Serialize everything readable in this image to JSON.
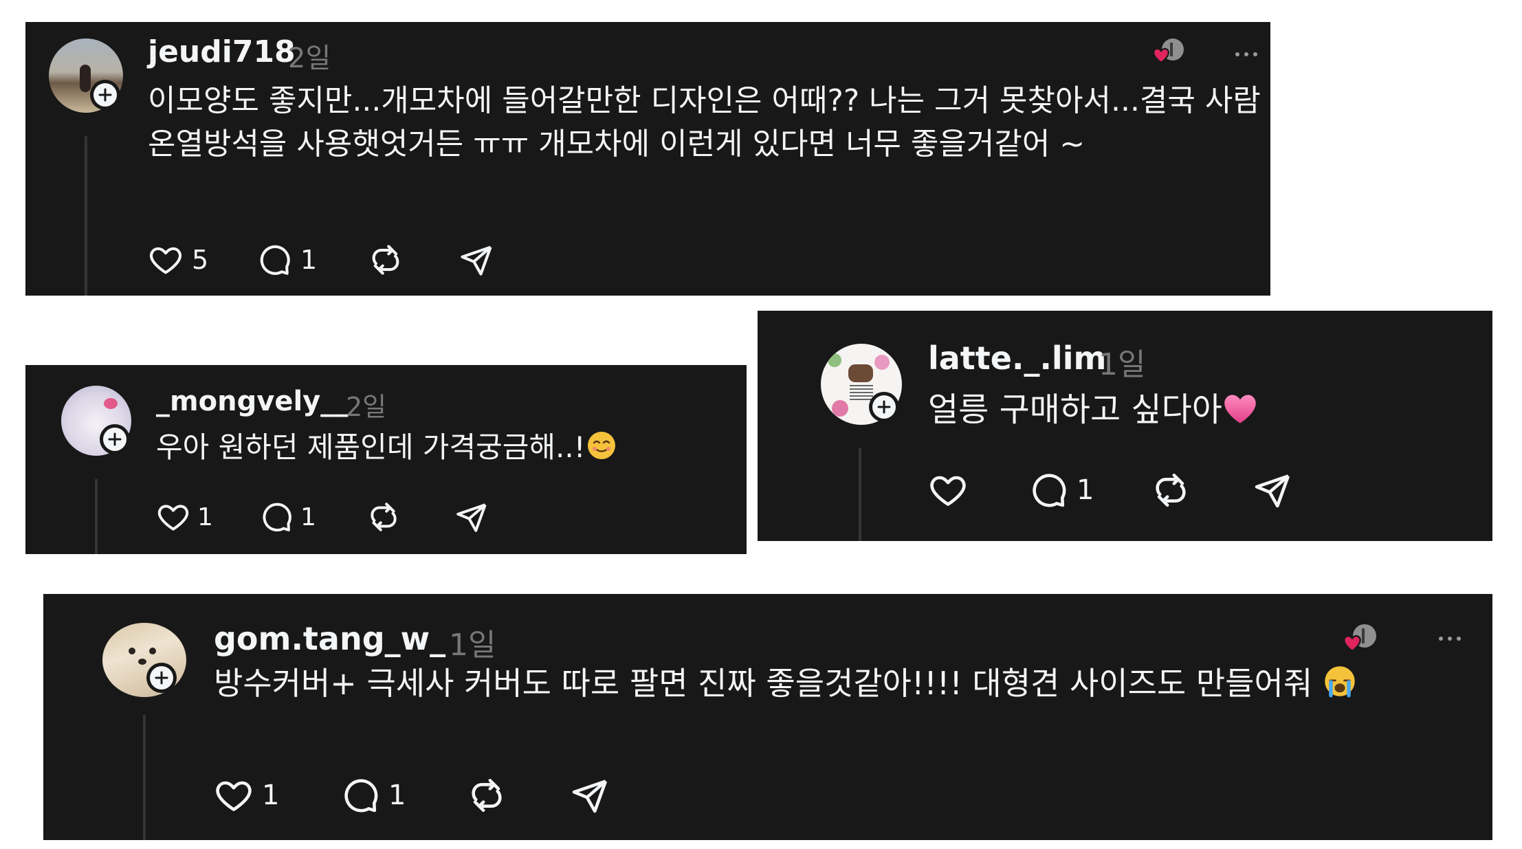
{
  "comments": [
    {
      "username": "jeudi718",
      "time": "2일",
      "text": "이모양도 좋지만...개모차에 들어갈만한 디자인은 어때?? 나는 그거 못찾아서...결국 사람 온열방석을 사용햇엇거든 ㅠㅠ 개모차에 이런게 있다면 너무 좋을거같어 ~",
      "likes": "5",
      "replies": "1"
    },
    {
      "username": "_mongvely__",
      "time": "2일",
      "text": "우아 원하던 제품인데 가격궁금해..!",
      "likes": "1",
      "replies": "1"
    },
    {
      "username": "latte._.lim",
      "time": "1일",
      "text": "얼릉 구매하고 싶다아",
      "likes": "",
      "replies": "1"
    },
    {
      "username": "gom.tang_w_",
      "time": "1일",
      "text": "방수커버+ 극세사 커버도 따로 팔면 진짜 좋을것같아!!!! 대형견 사이즈도 만들어줘",
      "likes": "1",
      "replies": "1"
    }
  ],
  "icons": {
    "like": "heart-icon",
    "reply": "comment-icon",
    "repost": "repost-icon",
    "share": "send-icon",
    "follow": "plus-icon",
    "more": "more-dots-icon",
    "liked_by_author": "author-liked-badge-icon"
  },
  "colors": {
    "card_bg": "#181818",
    "text": "#f3f5f7",
    "muted": "#777777",
    "heart_red": "#e0245e"
  }
}
